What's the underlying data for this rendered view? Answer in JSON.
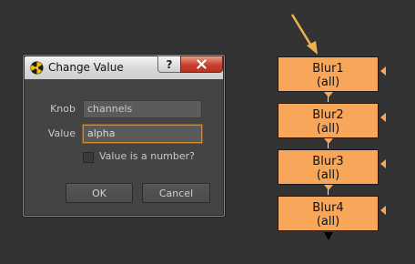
{
  "dialog": {
    "title": "Change Value",
    "help_label": "?",
    "knob_label": "Knob",
    "knob_value": "channels",
    "value_label": "Value",
    "value_value": "alpha",
    "checkbox_label": "Value is a number?",
    "checkbox_checked": false,
    "ok_label": "OK",
    "cancel_label": "Cancel"
  },
  "nodes": [
    {
      "name": "Blur1",
      "sub": "(all)"
    },
    {
      "name": "Blur2",
      "sub": "(all)"
    },
    {
      "name": "Blur3",
      "sub": "(all)"
    },
    {
      "name": "Blur4",
      "sub": "(all)"
    }
  ],
  "colors": {
    "node_fill": "#f7a65a",
    "arrow": "#f0b24f",
    "accent_focus": "#d68a2a",
    "background": "#333333"
  }
}
